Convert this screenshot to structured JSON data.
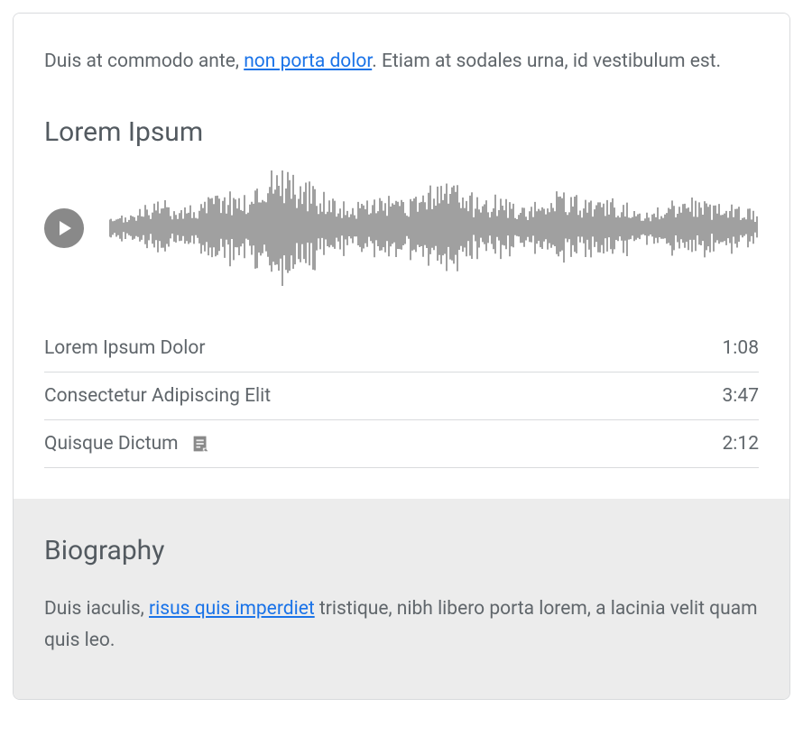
{
  "intro": {
    "before": "Duis at commodo ante, ",
    "link": "non porta dolor",
    "after": ". Etiam at sodales urna, id vestibulum est."
  },
  "audio": {
    "title": "Lorem Ipsum",
    "tracks": [
      {
        "title": "Lorem Ipsum Dolor",
        "time": "1:08",
        "icon": false
      },
      {
        "title": "Consectetur Adipiscing Elit",
        "time": "3:47",
        "icon": false
      },
      {
        "title": "Quisque Dictum",
        "time": "2:12",
        "icon": true
      }
    ]
  },
  "bio": {
    "heading": "Biography",
    "before": "Duis iaculis, ",
    "link": "risus quis imperdiet",
    "after": " tristique, nibh libero porta lorem, a lacinia velit quam quis leo."
  }
}
